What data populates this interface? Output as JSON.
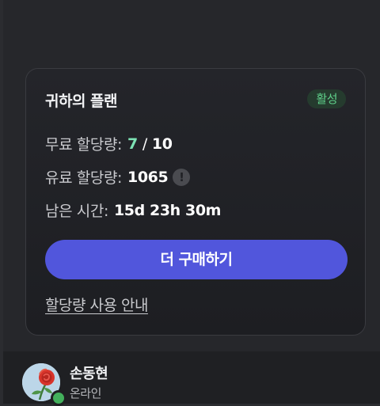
{
  "plan": {
    "title": "귀하의 플랜",
    "status_badge": "활성",
    "free_quota": {
      "label": "무료 할당량:",
      "used": "7",
      "separator": "/",
      "total": "10"
    },
    "paid_quota": {
      "label": "유료 할당량:",
      "value": "1065",
      "info_icon": "!"
    },
    "time_left": {
      "label": "남은 시간:",
      "value": "15d 23h 30m"
    },
    "buy_button_label": "더 구매하기",
    "guide_link_label": "할당량 사용 안내"
  },
  "user": {
    "name": "손동현",
    "status": "온라인"
  },
  "colors": {
    "accent_button": "#5156dc",
    "badge_text": "#5fd08a",
    "free_used_accent": "#7de3b5",
    "presence_online": "#43b05c"
  },
  "icons": {
    "info": "info-icon",
    "avatar": "rose-avatar-icon"
  }
}
